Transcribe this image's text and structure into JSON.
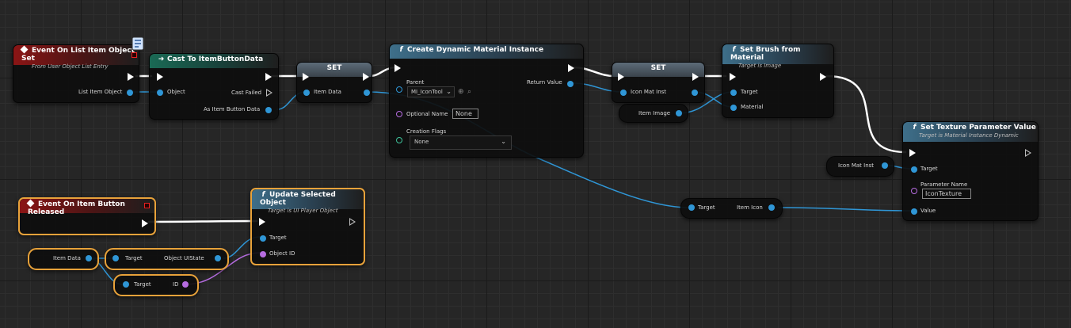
{
  "graph": {
    "nodes": {
      "event_list_item": {
        "title": "Event On List Item Object Set",
        "subtitle": "From User Object List Entry",
        "pins": {
          "list_item_object": "List Item Object"
        }
      },
      "cast": {
        "title": "Cast To ItemButtonData",
        "pins": {
          "object": "Object",
          "cast_failed": "Cast Failed",
          "as_item_button_data": "As Item Button Data"
        }
      },
      "set1": {
        "title": "SET",
        "pins": {
          "item_data": "Item Data"
        }
      },
      "create_dmi": {
        "title": "Create Dynamic Material Instance",
        "pins": {
          "parent": "Parent",
          "parent_value": "MI_IconTool",
          "optional_name": "Optional Name",
          "optional_name_value": "None",
          "creation_flags": "Creation Flags",
          "creation_flags_value": "None",
          "return_value": "Return Value"
        }
      },
      "set2": {
        "title": "SET",
        "pins": {
          "icon_mat_inst": "Icon Mat Inst"
        }
      },
      "item_image_var": {
        "label": "Item Image"
      },
      "set_brush": {
        "title": "Set Brush from Material",
        "subtitle": "Target is Image",
        "pins": {
          "target": "Target",
          "material": "Material"
        }
      },
      "icon_mat_inst_var": {
        "label": "Icon Mat Inst"
      },
      "set_texture": {
        "title": "Set Texture Parameter Value",
        "subtitle": "Target is Material Instance Dynamic",
        "pins": {
          "target": "Target",
          "parameter_name": "Parameter Name",
          "parameter_name_value": "IconTexture",
          "value": "Value"
        }
      },
      "get_item_icon": {
        "target": "Target",
        "output": "Item Icon"
      },
      "event_released": {
        "title": "Event On Item Button Released"
      },
      "update_selected": {
        "title": "Update Selected Object",
        "subtitle": "Target is UI Player Object",
        "pins": {
          "target": "Target",
          "object_id": "Object ID"
        }
      },
      "item_data_var": {
        "label": "Item Data"
      },
      "get_object_uistate": {
        "target": "Target",
        "output": "Object UIState"
      },
      "get_id": {
        "target": "Target",
        "output": "ID"
      }
    }
  },
  "icons": {
    "event": "event-diamond-icon",
    "function": "function-f-icon",
    "cast": "cast-arrow-icon",
    "search": "magnifier-icon",
    "browse": "browse-arrow-icon",
    "dropdown": "chevron-down-icon"
  },
  "colors": {
    "exec": "#ffffff",
    "object_pin": "#2f96d6",
    "int_pin": "#b66ce0",
    "struct_pin": "#3ec29a",
    "selection": "#e8a23a",
    "event_header": "#8b1515",
    "function_header": "#3e6f8a",
    "cast_header": "#1a6a55"
  }
}
